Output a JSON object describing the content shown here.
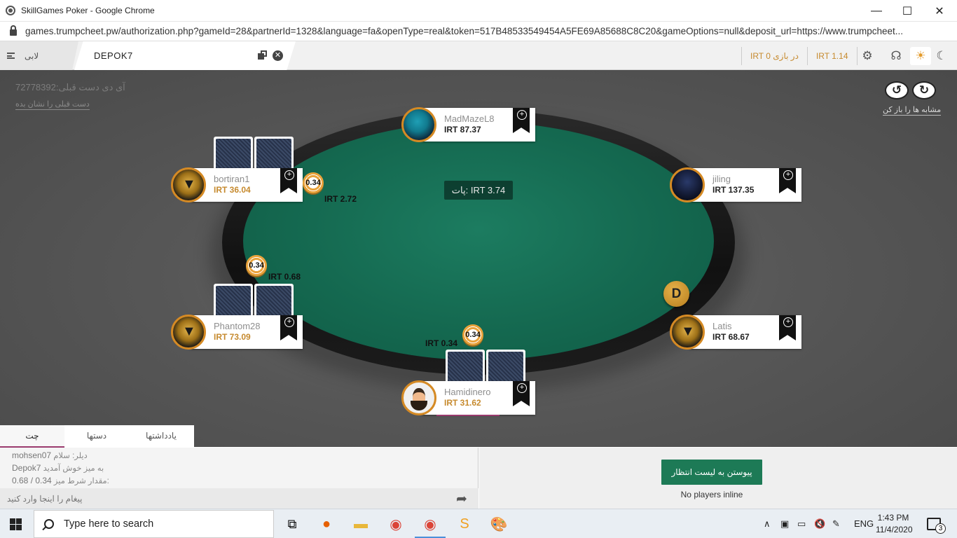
{
  "window": {
    "title": "SkillGames Poker - Google Chrome",
    "minimize": "—",
    "maximize": "☐",
    "close": "✕"
  },
  "address": {
    "url": "games.trumpcheet.pw/authorization.php?gameId=28&partnerId=1328&language=fa&openType=real&token=517B48533549454A5FE69A85688C8C20&gameOptions=null&deposit_url=https://www.trumpcheet..."
  },
  "gamebar": {
    "lobby_label": "لابی",
    "table_name": "DEPOK7",
    "close_glyph": "✕",
    "in_play_balance": "IRT 0 در بازی",
    "balance": "IRT 1.14"
  },
  "room": {
    "hand_id": "آی دی دست قبلی:72778392",
    "show_hand": "دست قبلی را نشان بده",
    "replay_label": "مشابه ها را باز کن",
    "pot": "پات: IRT 3.74",
    "dealer": "D"
  },
  "seats": [
    {
      "name": "MadMazeL8",
      "stack": "IRT 87.37"
    },
    {
      "name": "bortiran1",
      "stack": "IRT 36.04"
    },
    {
      "name": "jiling",
      "stack": "IRT 137.35"
    },
    {
      "name": "Phantom28",
      "stack": "IRT 73.09"
    },
    {
      "name": "Latis",
      "stack": "IRT 68.67"
    },
    {
      "name": "Hamidinero",
      "stack": "IRT 31.62"
    }
  ],
  "bets": [
    {
      "chip": "0.34",
      "amount": "IRT 2.72"
    },
    {
      "chip": "0.34",
      "amount": "IRT 0.68"
    },
    {
      "chip": "0.34",
      "amount": "IRT 0.34"
    }
  ],
  "chat": {
    "tabs": [
      "یادداشتها",
      "دستها",
      "چت"
    ],
    "lines": [
      {
        "user": "mohsen07",
        "text": "دیلر: سلام"
      },
      {
        "user": "Depok7",
        "text": "به میز خوش آمدید"
      },
      {
        "user": "0.68 / 0.34",
        "text": "مقدار شرط میز:"
      }
    ],
    "input_placeholder": "پیغام را اینجا وارد کنید"
  },
  "waitlist": {
    "button": "پیوستن به لیست انتظار",
    "status": "No players inline"
  },
  "taskbar": {
    "search_placeholder": "Type here to search",
    "language": "ENG",
    "time": "1:43 PM",
    "date": "11/4/2020",
    "notifications": "3"
  }
}
